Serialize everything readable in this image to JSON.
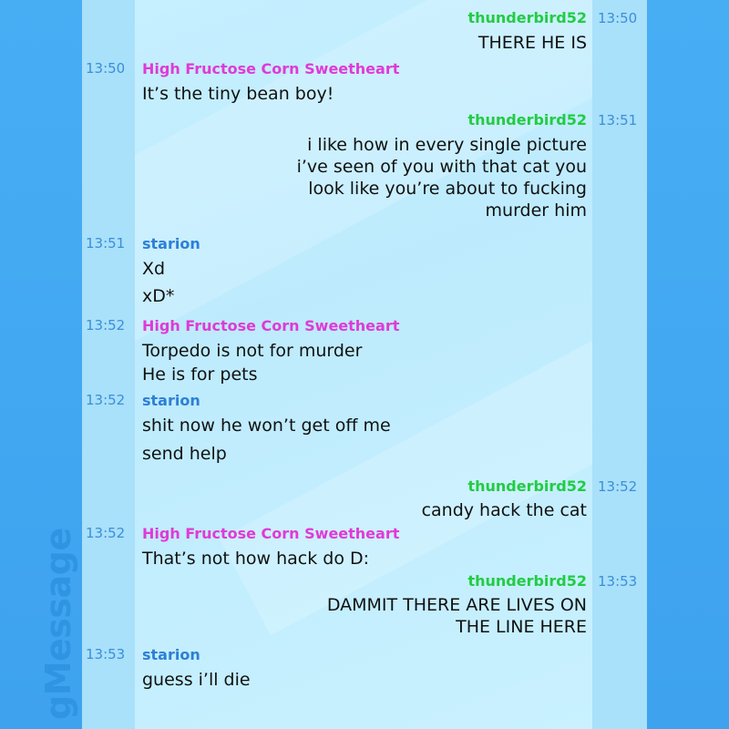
{
  "app": {
    "brand": "gMessage"
  },
  "users": {
    "thunderbird": {
      "name": "thunderbird52",
      "color": "#22cc44"
    },
    "hfcs": {
      "name": "High Fructose Corn Sweetheart",
      "color": "#e03ad6"
    },
    "starion": {
      "name": "starion",
      "color": "#2d7fd6"
    }
  },
  "messages": [
    {
      "author": "thunderbird52",
      "time": "13:50",
      "lines": [
        "THERE HE IS"
      ]
    },
    {
      "author": "High Fructose Corn Sweetheart",
      "time": "13:50",
      "lines": [
        "It’s the tiny bean boy!"
      ]
    },
    {
      "author": "thunderbird52",
      "time": "13:51",
      "lines": [
        "i like how in every single picture",
        "i’ve seen of you with that cat you",
        "look like you’re about to fucking",
        "murder him"
      ]
    },
    {
      "author": "starion",
      "time": "13:51",
      "lines": [
        "Xd",
        "xD*"
      ]
    },
    {
      "author": "High Fructose Corn Sweetheart",
      "time": "13:52",
      "lines": [
        "Torpedo is not for murder",
        "He is for pets"
      ]
    },
    {
      "author": "starion",
      "time": "13:52",
      "lines": [
        "shit now he won’t get off me",
        "send help"
      ]
    },
    {
      "author": "thunderbird52",
      "time": "13:52",
      "lines": [
        "candy hack the cat"
      ]
    },
    {
      "author": "High Fructose Corn Sweetheart",
      "time": "13:52",
      "lines": [
        "That’s not how hack do D:"
      ]
    },
    {
      "author": "thunderbird52",
      "time": "13:53",
      "lines": [
        "DAMMIT THERE ARE LIVES ON",
        "THE LINE HERE"
      ]
    },
    {
      "author": "starion",
      "time": "13:53",
      "lines": [
        "guess i’ll die"
      ]
    }
  ]
}
